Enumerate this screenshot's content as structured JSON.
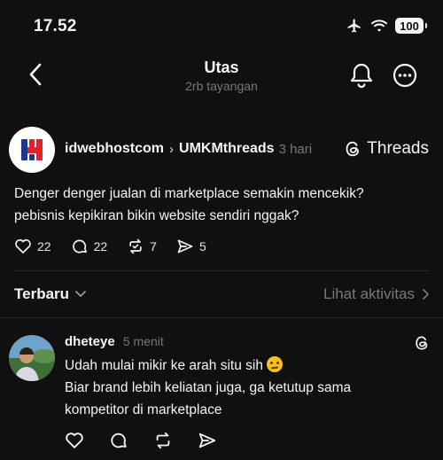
{
  "status_bar": {
    "time": "17.52",
    "battery": "100"
  },
  "header": {
    "title": "Utas",
    "subtitle": "2rb tayangan"
  },
  "post": {
    "author": "idwebhostcom",
    "community": "UMKMthreads",
    "time": "3 hari",
    "source": "Threads",
    "text_line1": "Denger denger jualan di marketplace semakin mencekik?",
    "text_line2": "pebisnis kepikiran bikin website sendiri nggak?",
    "likes": "22",
    "replies": "22",
    "reposts": "7",
    "shares": "5"
  },
  "sort": {
    "label": "Terbaru",
    "activity_link": "Lihat aktivitas"
  },
  "reply": {
    "author": "dheteye",
    "time": "5 menit",
    "line1": "Udah mulai mikir ke arah situ sih",
    "line2": "Biar brand lebih keliatan juga, ga ketutup sama",
    "line3": "kompetitor di marketplace"
  },
  "colors": {
    "background": "#101010",
    "text": "#f3f5f7",
    "muted": "#777777",
    "divider": "#2a2a2a",
    "logo_red": "#e4212b",
    "logo_blue": "#1d3a8a"
  }
}
